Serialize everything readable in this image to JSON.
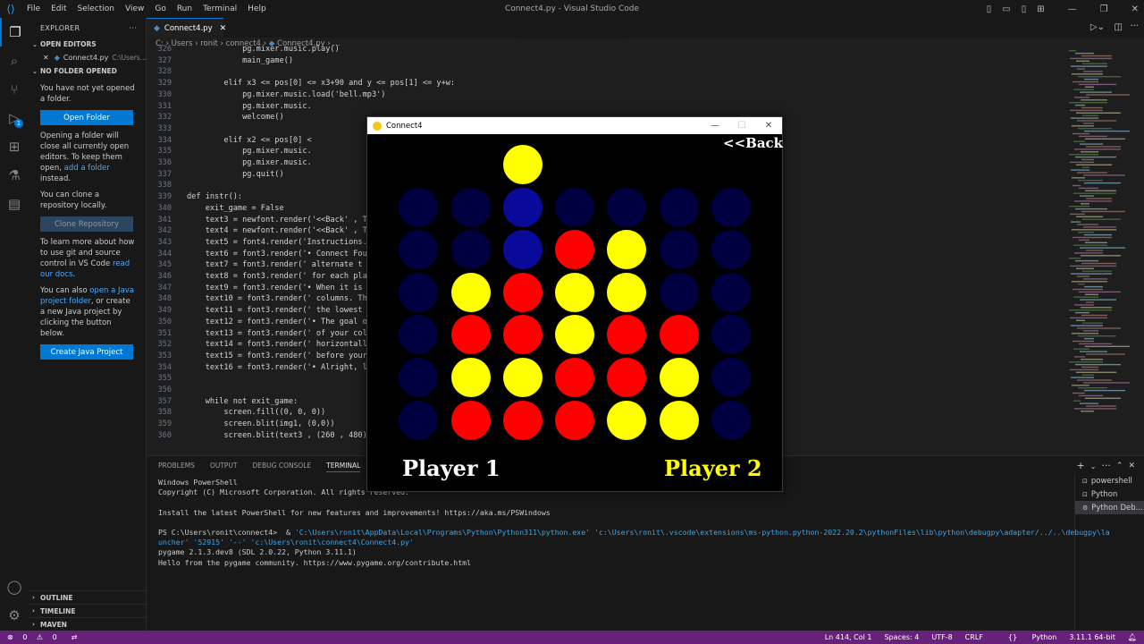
{
  "titlebar": {
    "menu": [
      "File",
      "Edit",
      "Selection",
      "View",
      "Go",
      "Run",
      "Terminal",
      "Help"
    ],
    "title": "Connect4.py - Visual Studio Code"
  },
  "sidebar": {
    "explorer_label": "EXPLORER",
    "more": "···",
    "open_editors_label": "OPEN EDITORS",
    "open_editor_file": "Connect4.py",
    "open_editor_path": "C:\\Users...",
    "no_folder_label": "NO FOLDER OPENED",
    "not_opened_text": "You have not yet opened a folder.",
    "open_folder_button": "Open Folder",
    "closing_text_1": "Opening a folder will close all currently open editors. To keep them open, ",
    "add_folder_link": "add a folder",
    "closing_text_2": " instead.",
    "clone_text": "You can clone a repository locally.",
    "clone_button": "Clone Repository",
    "git_text_1": "To learn more about how to use git and source control in VS Code ",
    "read_docs_link": "read our docs",
    "git_text_2": ".",
    "java_text_1": "You can also ",
    "java_link": "open a Java project folder",
    "java_text_2": ", or create a new Java project by clicking the button below.",
    "create_java_button": "Create Java Project",
    "outline_label": "OUTLINE",
    "timeline_label": "TIMELINE",
    "maven_label": "MAVEN"
  },
  "editor": {
    "tab_label": "Connect4.py",
    "breadcrumb": [
      "C:",
      "Users",
      "ronit",
      "connect4",
      "Connect4.py",
      "..."
    ],
    "lines": [
      {
        "n": "326",
        "t": "            pg.mixer.music.play()"
      },
      {
        "n": "327",
        "t": "            main_game()"
      },
      {
        "n": "328",
        "t": ""
      },
      {
        "n": "329",
        "t": "        elif x3 <= pos[0] <= x3+90 and y <= pos[1] <= y+w:"
      },
      {
        "n": "330",
        "t": "            pg.mixer.music.load('bell.mp3')"
      },
      {
        "n": "331",
        "t": "            pg.mixer.music."
      },
      {
        "n": "332",
        "t": "            welcome()"
      },
      {
        "n": "333",
        "t": ""
      },
      {
        "n": "334",
        "t": "        elif x2 <= pos[0] <"
      },
      {
        "n": "335",
        "t": "            pg.mixer.music."
      },
      {
        "n": "336",
        "t": "            pg.mixer.music."
      },
      {
        "n": "337",
        "t": "            pg.quit()"
      },
      {
        "n": "338",
        "t": ""
      },
      {
        "n": "339",
        "t": "def instr():"
      },
      {
        "n": "340",
        "t": "    exit_game = False"
      },
      {
        "n": "341",
        "t": "    text3 = newfont.render('<<Back' , T"
      },
      {
        "n": "342",
        "t": "    text4 = newfont.render('<<Back' , T"
      },
      {
        "n": "343",
        "t": "    text5 = font4.render('Instructions."
      },
      {
        "n": "344",
        "t": "    text6 = font3.render('• Connect Fou"
      },
      {
        "n": "345",
        "t": "    text7 = font3.render(' alternate t"
      },
      {
        "n": "346",
        "t": "    text8 = font3.render(' for each pla"
      },
      {
        "n": "347",
        "t": "    text9 = font3.render('• When it is"
      },
      {
        "n": "348",
        "t": "    text10 = font3.render(' columns. Th"
      },
      {
        "n": "349",
        "t": "    text11 = font3.render(' the lowest"
      },
      {
        "n": "350",
        "t": "    text12 = font3.render('• The goal o"
      },
      {
        "n": "351",
        "t": "    text13 = font3.render(' of your col"
      },
      {
        "n": "352",
        "t": "    text14 = font3.render(' horizontall"
      },
      {
        "n": "353",
        "t": "    text15 = font3.render(' before your"
      },
      {
        "n": "354",
        "t": "    text16 = font3.render('• Alright, l"
      },
      {
        "n": "355",
        "t": ""
      },
      {
        "n": "356",
        "t": ""
      },
      {
        "n": "357",
        "t": "    while not exit_game:"
      },
      {
        "n": "358",
        "t": "        screen.fill((0, 0, 0))"
      },
      {
        "n": "359",
        "t": "        screen.blit(img1, (0,0))"
      },
      {
        "n": "360",
        "t": "        screen.blit(text3 , (260 , 480)"
      }
    ]
  },
  "panel": {
    "tabs": [
      "PROBLEMS",
      "OUTPUT",
      "DEBUG CONSOLE",
      "TERMINAL"
    ],
    "active_tab": "TERMINAL",
    "terminal_lines": [
      "Windows PowerShell",
      "Copyright (C) Microsoft Corporation. All rights reserved.",
      "",
      "Install the latest PowerShell for new features and improvements! https://aka.ms/PSWindows",
      "",
      "PS C:\\Users\\ronit\\connect4>  & ",
      "uncher' '52915' '--' 'c:\\Users\\ronit\\connect4\\Connect4.py'",
      "pygame 2.1.3.dev8 (SDL 2.0.22, Python 3.11.1)",
      "Hello from the pygame community. https://www.pygame.org/contribute.html"
    ],
    "terminal_cmd": "'C:\\Users\\ronit\\AppData\\Local\\Programs\\Python\\Python311\\python.exe' 'c:\\Users\\ronit\\.vscode\\extensions\\ms-python.python-2022.20.2\\pythonFiles\\lib\\python\\debugpy\\adapter/../..\\debugpy\\la",
    "terminals": [
      "powershell",
      "Python",
      "Python Deb..."
    ]
  },
  "statusbar": {
    "errors": "0",
    "warnings": "0",
    "position": "Ln 414, Col 1",
    "spaces": "Spaces: 4",
    "encoding": "UTF-8",
    "eol": "CRLF",
    "language": "Python",
    "interpreter": "3.11.1 64-bit"
  },
  "game": {
    "window_title": "Connect4",
    "back_label": "<<Back",
    "player1_label": "Player 1",
    "player2_label": "Player 2",
    "colors": {
      "background": "#000000",
      "empty": "#000040",
      "highlight_column": "#0a0a9a",
      "red": "#ff0000",
      "yellow": "#ffff00",
      "player1_text": "#ffffff",
      "player2_text": "#ffff00"
    },
    "hover_column": 3,
    "hover_piece": "Y",
    "board": [
      [
        "E",
        "E",
        "E",
        "E",
        "E",
        "E",
        "E"
      ],
      [
        "E",
        "E",
        "E",
        "R",
        "Y",
        "E",
        "E"
      ],
      [
        "E",
        "Y",
        "R",
        "Y",
        "Y",
        "E",
        "E"
      ],
      [
        "E",
        "R",
        "R",
        "Y",
        "R",
        "R",
        "E"
      ],
      [
        "E",
        "Y",
        "Y",
        "R",
        "R",
        "Y",
        "E"
      ],
      [
        "E",
        "R",
        "R",
        "R",
        "Y",
        "Y",
        "E"
      ]
    ]
  }
}
